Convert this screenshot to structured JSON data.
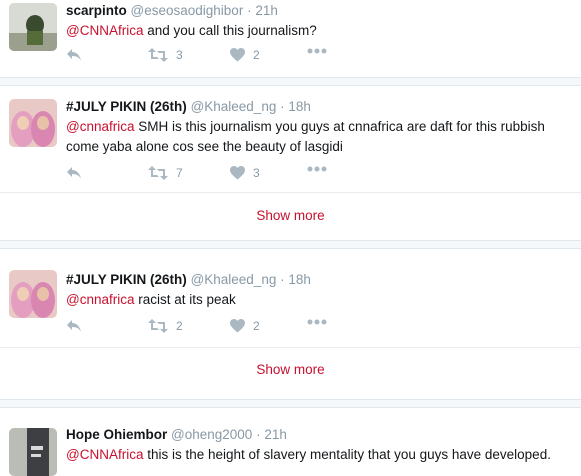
{
  "tweets": [
    {
      "name": "scarpinto",
      "handle": "@eseosaodighibor",
      "time": "21h",
      "mention": "@CNNAfrica",
      "text": " and you call this journalism?",
      "retweets": "3",
      "likes": "2"
    },
    {
      "name": "#JULY PIKIN (26th)",
      "handle": "@Khaleed_ng",
      "time": "18h",
      "mention": "@cnnafrica",
      "text": " SMH is this journalism you guys at cnnafrica are daft for this rubbish come yaba alone cos see the beauty of lasgidi",
      "retweets": "7",
      "likes": "3",
      "show_more": "Show more"
    },
    {
      "name": "#JULY PIKIN (26th)",
      "handle": "@Khaleed_ng",
      "time": "18h",
      "mention": "@cnnafrica",
      "text": " racist at its peak",
      "retweets": "2",
      "likes": "2",
      "show_more": "Show more"
    },
    {
      "name": "Hope Ohiembor",
      "handle": "@oheng2000",
      "time": "21h",
      "mention": "@CNNAfrica",
      "text": " this is the height of slavery mentality that you guys have developed."
    }
  ],
  "separator": " · ",
  "colors": {
    "accent": "#c8102e",
    "muted": "#8899a6",
    "text": "#14171a"
  },
  "icons": [
    "reply-icon",
    "retweet-icon",
    "like-icon",
    "more-icon"
  ]
}
